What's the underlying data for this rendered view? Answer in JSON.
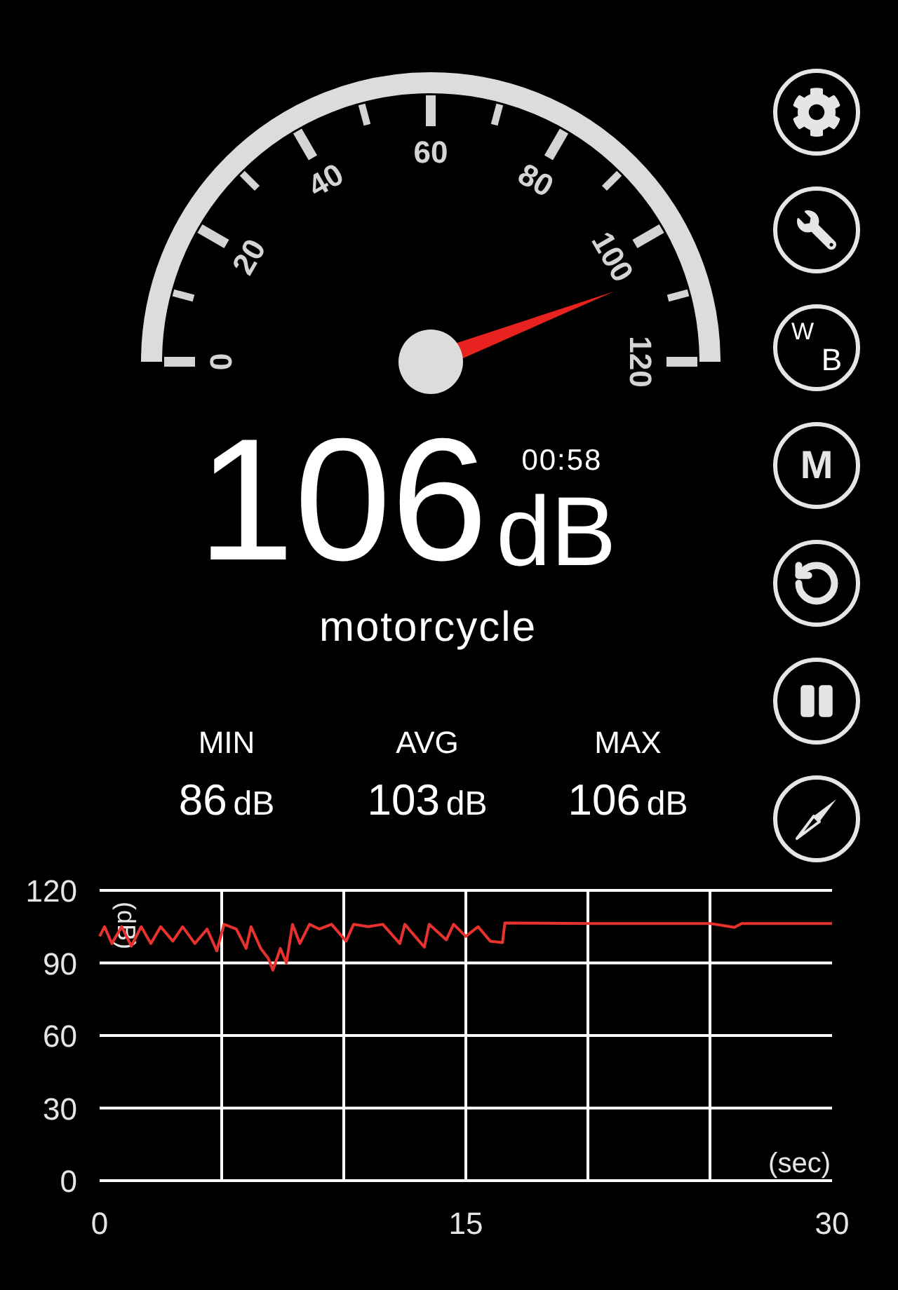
{
  "gauge": {
    "labels": [
      "0",
      "20",
      "40",
      "60",
      "80",
      "100",
      "120"
    ]
  },
  "reading": {
    "value": "106",
    "unit": "dB",
    "time": "00:58",
    "description": "motorcycle"
  },
  "stats": [
    {
      "label": "MIN",
      "value": "86",
      "unit": "dB"
    },
    {
      "label": "AVG",
      "value": "103",
      "unit": "dB"
    },
    {
      "label": "MAX",
      "value": "106",
      "unit": "dB"
    }
  ],
  "buttons": [
    {
      "kind": "settings"
    },
    {
      "kind": "wrench"
    },
    {
      "kind": "wb",
      "label_top": "W",
      "label_bottom": "B"
    },
    {
      "kind": "text",
      "label": "M"
    },
    {
      "kind": "reset"
    },
    {
      "kind": "pause"
    },
    {
      "kind": "compass"
    }
  ],
  "chart": {
    "chart_data": {
      "type": "line",
      "xlabel": "(sec)",
      "ylabel": "(dB)",
      "xlim": [
        0,
        30
      ],
      "ylim": [
        0,
        120
      ],
      "grid": true,
      "xticks": [
        0,
        15,
        30
      ],
      "yticks": [
        0,
        30,
        60,
        90,
        120
      ],
      "x": [
        0,
        0.2,
        0.5,
        0.9,
        1.3,
        1.7,
        2.1,
        2.5,
        3,
        3.4,
        3.9,
        4.4,
        4.8,
        5.1,
        5.6,
        6,
        6.2,
        6.6,
        6.9,
        7.1,
        7.4,
        7.65,
        7.9,
        8.2,
        8.6,
        9,
        9.5,
        10.1,
        10.4,
        11,
        11.6,
        12.3,
        12.5,
        13.3,
        13.5,
        14.2,
        14.5,
        15,
        15.5,
        16,
        16.5,
        16.6,
        20,
        25,
        26,
        26.3,
        30
      ],
      "series": [
        {
          "color": "#e8322e",
          "values": [
            101,
            105,
            98,
            105,
            97,
            105,
            98,
            105,
            99,
            105,
            98,
            104,
            95,
            106,
            104,
            96,
            105,
            96,
            92,
            87,
            96,
            90,
            106,
            98,
            106,
            104,
            106,
            99,
            106,
            105,
            106,
            98,
            106,
            96.5,
            106,
            99.6,
            106,
            101,
            105,
            99,
            98.4,
            106.5,
            106.3,
            106.3,
            104.7,
            106.3,
            106.3
          ]
        }
      ]
    }
  }
}
